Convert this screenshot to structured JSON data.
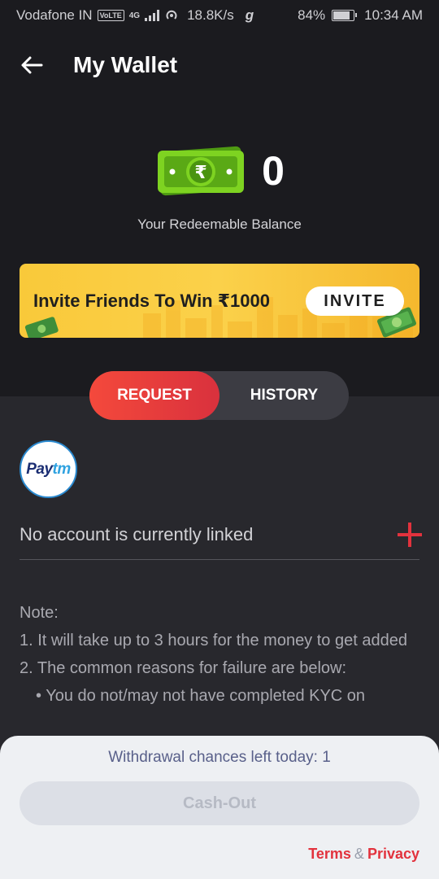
{
  "status_bar": {
    "carrier": "Vodafone IN",
    "network_badge": "VoLTE",
    "network_gen": "4G",
    "speed": "18.8K/s",
    "app_glyph": "g",
    "battery": "84%",
    "battery_level": 0.84,
    "time": "10:34 AM"
  },
  "header": {
    "title": "My Wallet",
    "back_icon": "arrow-left-icon"
  },
  "balance": {
    "value": "0",
    "label": "Your Redeemable Balance",
    "icon": "rupee-cash-icon"
  },
  "banner": {
    "text": "Invite Friends To Win ₹1000",
    "button_label": "INVITE"
  },
  "tabs": [
    {
      "label": "REQUEST",
      "active": true
    },
    {
      "label": "HISTORY",
      "active": false
    }
  ],
  "payment": {
    "logo_part1": "Pay",
    "logo_part2": "tm",
    "link_status": "No account is currently linked",
    "add_icon": "plus-icon"
  },
  "notes": {
    "heading": "Note:",
    "line1": "1. It will take up to 3 hours for the money to get added",
    "line2": "2. The common reasons for failure are below:",
    "bullet1": "• You do not/may not have completed KYC on"
  },
  "sheet": {
    "chances_text": "Withdrawal chances left today: 1",
    "cashout_label": "Cash-Out",
    "terms_label": "Terms",
    "amp": "&",
    "privacy_label": "Privacy"
  },
  "colors": {
    "accent_red": "#e2323d",
    "banner_yellow": "#fbd14a",
    "cash_green": "#7ed321",
    "background_dark": "#1b1b1f"
  }
}
